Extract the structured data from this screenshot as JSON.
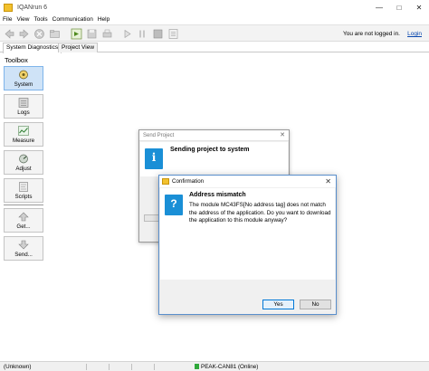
{
  "window": {
    "title": "IQANrun 6",
    "app_icon": "IQAN"
  },
  "menu": [
    "File",
    "View",
    "Tools",
    "Communication",
    "Help"
  ],
  "toolbar": {
    "login_status": "You are not logged in.",
    "login_link": "Login"
  },
  "tabs": [
    "System Diagnostics",
    "Project View"
  ],
  "toolbox": {
    "title": "Toolbox",
    "items": [
      "System",
      "Logs",
      "Measure",
      "Adjust",
      "Scripts",
      "Get...",
      "Send..."
    ]
  },
  "send_dialog": {
    "title": "Send Project",
    "heading": "Sending project to system",
    "icon": "i"
  },
  "confirm_dialog": {
    "title": "Confirmation",
    "heading": "Address mismatch",
    "message": "The module MC43FS[No address tag] does not match the address of the application. Do you want to download the application to this module anyway?",
    "icon": "?",
    "yes": "Yes",
    "no": "No"
  },
  "statusbar": {
    "left": "(Unknown)",
    "connection": "PEAK-CAN81 (Online)"
  },
  "colors": {
    "accent": "#1a8fd6",
    "active_tool": "#cfe3f7",
    "online": "#2fa83a"
  }
}
